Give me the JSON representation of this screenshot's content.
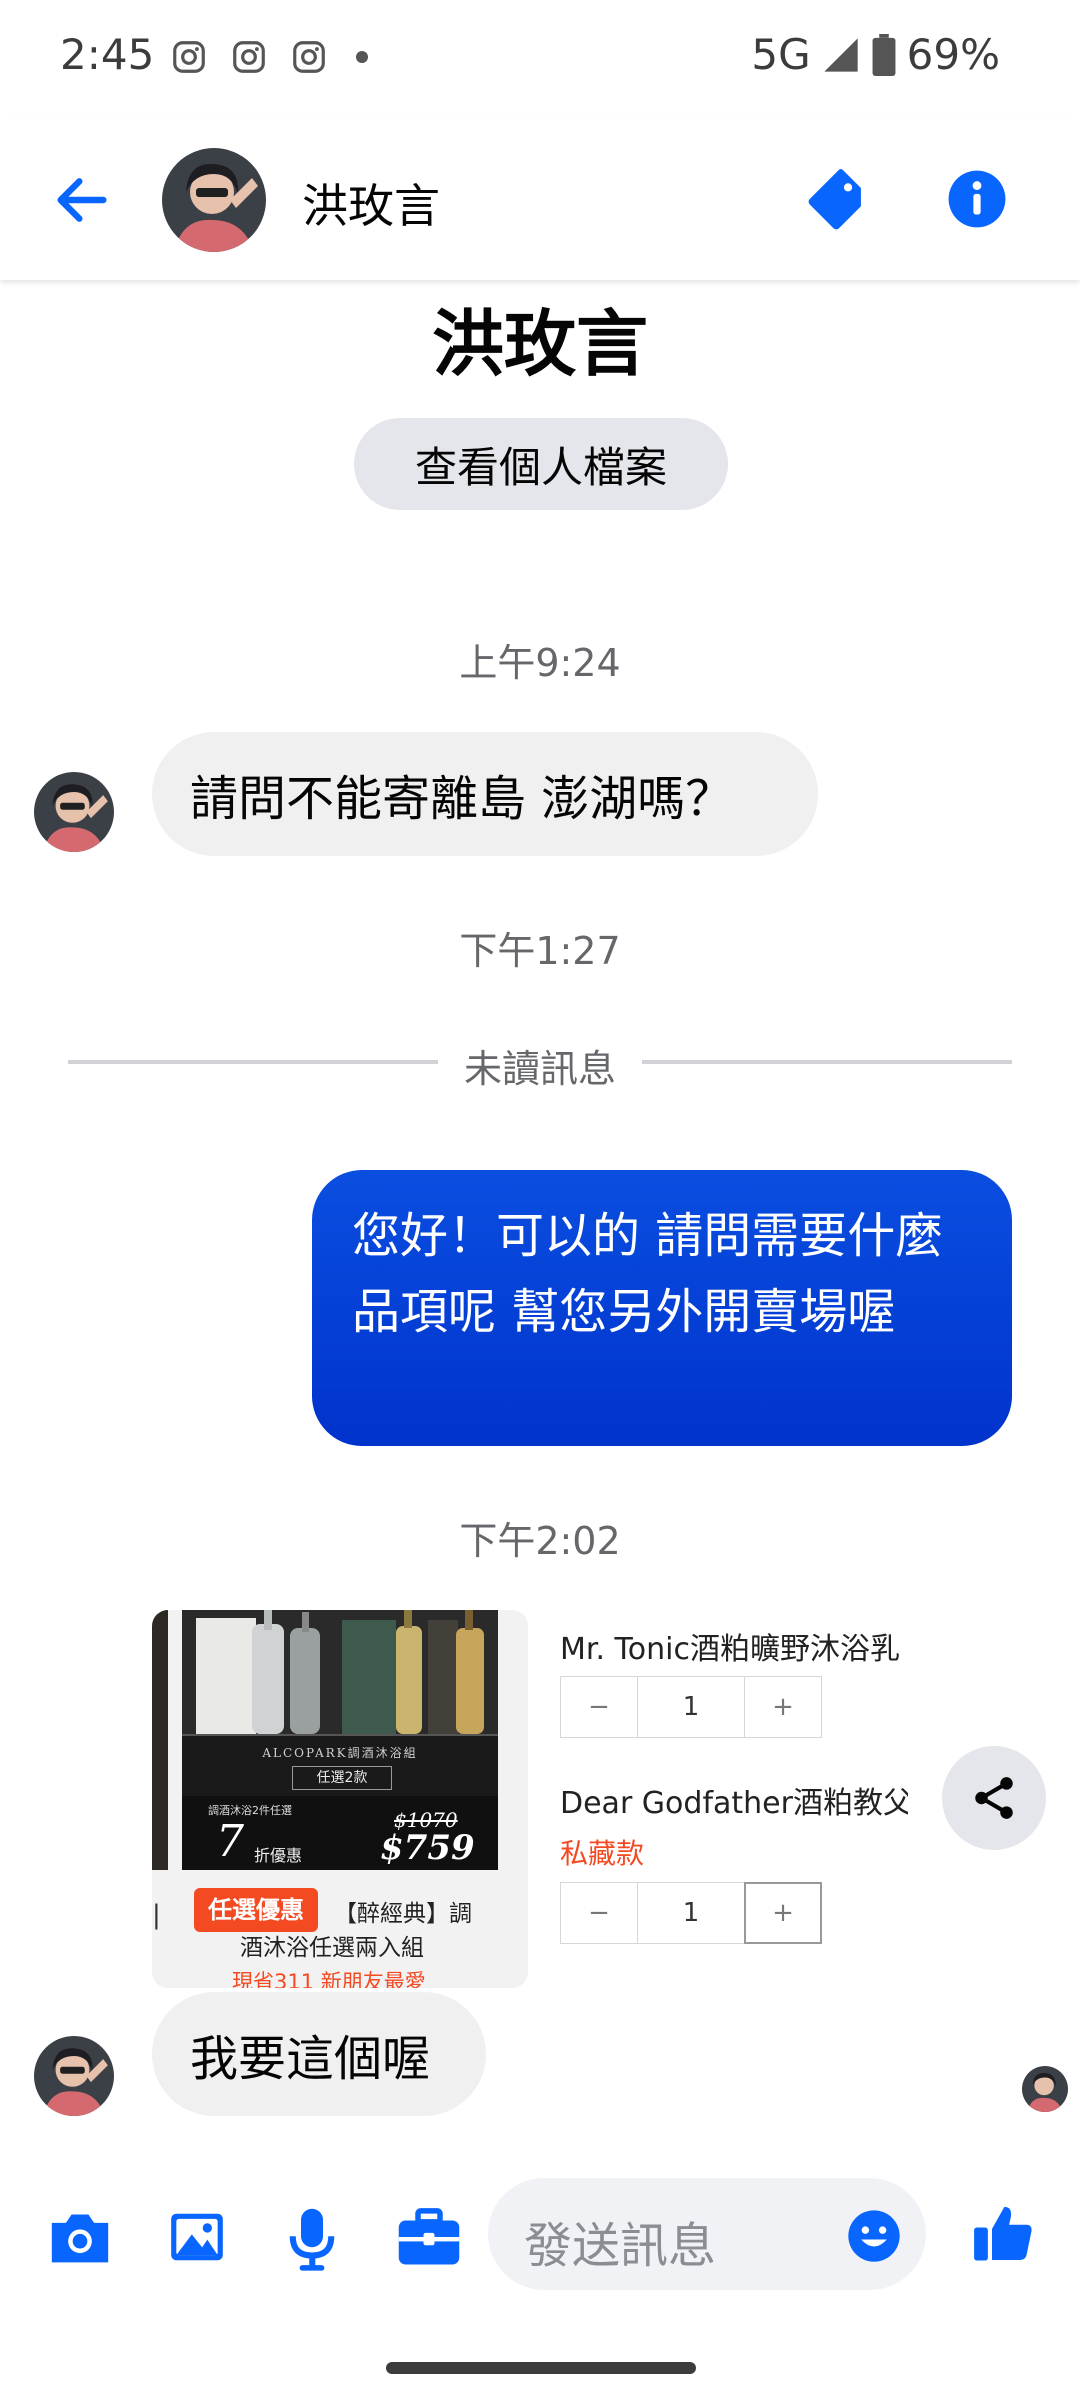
{
  "status_bar": {
    "time": "2:45",
    "network": "5G",
    "battery": "69%",
    "notification_icons": [
      "instagram-icon",
      "instagram-icon",
      "instagram-icon",
      "dot-icon"
    ]
  },
  "header": {
    "contact_name": "洪玫言"
  },
  "profile": {
    "name": "洪玫言",
    "view_profile_label": "查看個人檔案"
  },
  "messages": {
    "ts1": "上午9:24",
    "msg1": "請問不能寄離島 澎湖嗎？",
    "ts2": "下午1:27",
    "unread_divider": "未讀訊息",
    "msg2": "您好！可以的 請問需要什麼品項呢 幫您另外開賣場喔",
    "ts3": "下午2:02",
    "msg3": "我要這個喔"
  },
  "product_card": {
    "badge": "任選優惠",
    "title_line1": "【醉經典】調",
    "title_line2": "酒沐浴任選兩入組",
    "subtitle": "現省311 新朋友最愛",
    "image_brand": "ALCOPARK調酒沐浴組",
    "image_choose": "任選2款",
    "image_note": "調酒沐浴2件任選",
    "image_discount_number": "7",
    "image_discount_text": "折優惠",
    "image_price_old": "$1070",
    "image_price": "$759"
  },
  "product_options": [
    {
      "name": "Mr. Tonic酒粕曠野沐浴乳",
      "tag": "",
      "qty": "1"
    },
    {
      "name": "Dear Godfather酒粕教父沐浴乳",
      "tag": "私藏款",
      "qty": "1"
    }
  ],
  "stepper": {
    "minus": "−",
    "plus": "+"
  },
  "composer": {
    "placeholder": "發送訊息"
  },
  "colors": {
    "accent": "#0866ff",
    "outgoing_bubble": "#0a4ee0",
    "incoming_bubble": "#f0f0f0",
    "promo": "#f44a22"
  }
}
